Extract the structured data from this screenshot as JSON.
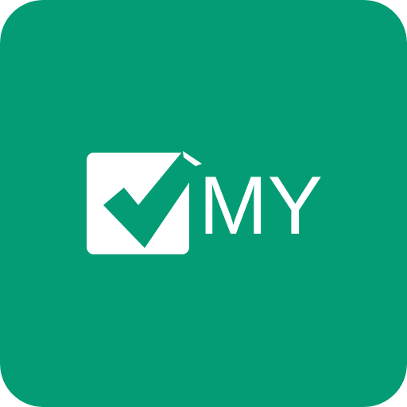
{
  "app_icon": {
    "background_color": "#049c74",
    "foreground_color": "#ffffff",
    "checkbox": {
      "icon": "checkbox-checked-icon",
      "checked": true
    },
    "logo_text": "MY"
  }
}
